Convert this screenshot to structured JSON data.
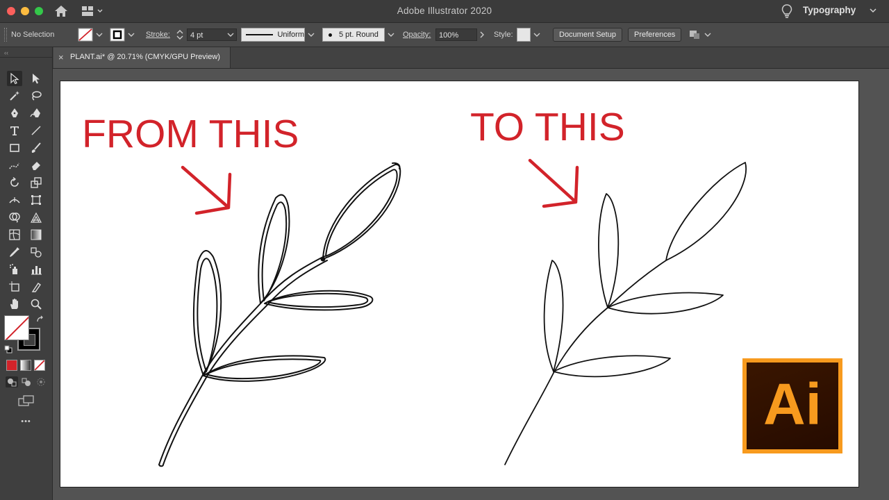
{
  "window": {
    "title": "Adobe Illustrator 2020",
    "workspace": "Typography"
  },
  "control_bar": {
    "selection": "No Selection",
    "stroke_label": "Stroke:",
    "stroke_weight": "4 pt",
    "profile": "Uniform",
    "brush": "5 pt. Round",
    "opacity_label": "Opacity:",
    "opacity_value": "100%",
    "style_label": "Style:",
    "document_setup": "Document Setup",
    "preferences": "Preferences"
  },
  "document_tab": {
    "close": "×",
    "label": "PLANT.ai* @ 20.71% (CMYK/GPU Preview)"
  },
  "toolbar": {
    "more": "•••",
    "grip": "‹‹"
  },
  "artwork": {
    "left_heading": "FROM THIS",
    "right_heading": "TO THIS",
    "logo_text": "Ai",
    "accent_color": "#d2232a",
    "logo_color": "#f79a1e"
  }
}
